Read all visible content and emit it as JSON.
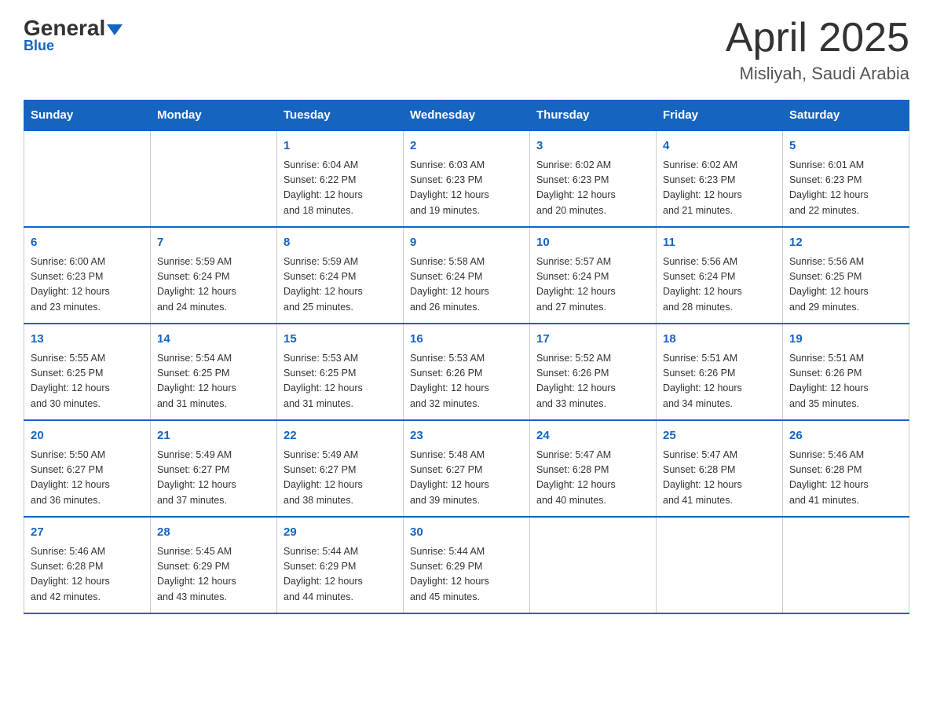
{
  "header": {
    "logo_general": "General",
    "logo_blue": "Blue",
    "month_year": "April 2025",
    "location": "Misliyah, Saudi Arabia"
  },
  "weekdays": [
    "Sunday",
    "Monday",
    "Tuesday",
    "Wednesday",
    "Thursday",
    "Friday",
    "Saturday"
  ],
  "weeks": [
    [
      {
        "day": "",
        "info": ""
      },
      {
        "day": "",
        "info": ""
      },
      {
        "day": "1",
        "info": "Sunrise: 6:04 AM\nSunset: 6:22 PM\nDaylight: 12 hours\nand 18 minutes."
      },
      {
        "day": "2",
        "info": "Sunrise: 6:03 AM\nSunset: 6:23 PM\nDaylight: 12 hours\nand 19 minutes."
      },
      {
        "day": "3",
        "info": "Sunrise: 6:02 AM\nSunset: 6:23 PM\nDaylight: 12 hours\nand 20 minutes."
      },
      {
        "day": "4",
        "info": "Sunrise: 6:02 AM\nSunset: 6:23 PM\nDaylight: 12 hours\nand 21 minutes."
      },
      {
        "day": "5",
        "info": "Sunrise: 6:01 AM\nSunset: 6:23 PM\nDaylight: 12 hours\nand 22 minutes."
      }
    ],
    [
      {
        "day": "6",
        "info": "Sunrise: 6:00 AM\nSunset: 6:23 PM\nDaylight: 12 hours\nand 23 minutes."
      },
      {
        "day": "7",
        "info": "Sunrise: 5:59 AM\nSunset: 6:24 PM\nDaylight: 12 hours\nand 24 minutes."
      },
      {
        "day": "8",
        "info": "Sunrise: 5:59 AM\nSunset: 6:24 PM\nDaylight: 12 hours\nand 25 minutes."
      },
      {
        "day": "9",
        "info": "Sunrise: 5:58 AM\nSunset: 6:24 PM\nDaylight: 12 hours\nand 26 minutes."
      },
      {
        "day": "10",
        "info": "Sunrise: 5:57 AM\nSunset: 6:24 PM\nDaylight: 12 hours\nand 27 minutes."
      },
      {
        "day": "11",
        "info": "Sunrise: 5:56 AM\nSunset: 6:24 PM\nDaylight: 12 hours\nand 28 minutes."
      },
      {
        "day": "12",
        "info": "Sunrise: 5:56 AM\nSunset: 6:25 PM\nDaylight: 12 hours\nand 29 minutes."
      }
    ],
    [
      {
        "day": "13",
        "info": "Sunrise: 5:55 AM\nSunset: 6:25 PM\nDaylight: 12 hours\nand 30 minutes."
      },
      {
        "day": "14",
        "info": "Sunrise: 5:54 AM\nSunset: 6:25 PM\nDaylight: 12 hours\nand 31 minutes."
      },
      {
        "day": "15",
        "info": "Sunrise: 5:53 AM\nSunset: 6:25 PM\nDaylight: 12 hours\nand 31 minutes."
      },
      {
        "day": "16",
        "info": "Sunrise: 5:53 AM\nSunset: 6:26 PM\nDaylight: 12 hours\nand 32 minutes."
      },
      {
        "day": "17",
        "info": "Sunrise: 5:52 AM\nSunset: 6:26 PM\nDaylight: 12 hours\nand 33 minutes."
      },
      {
        "day": "18",
        "info": "Sunrise: 5:51 AM\nSunset: 6:26 PM\nDaylight: 12 hours\nand 34 minutes."
      },
      {
        "day": "19",
        "info": "Sunrise: 5:51 AM\nSunset: 6:26 PM\nDaylight: 12 hours\nand 35 minutes."
      }
    ],
    [
      {
        "day": "20",
        "info": "Sunrise: 5:50 AM\nSunset: 6:27 PM\nDaylight: 12 hours\nand 36 minutes."
      },
      {
        "day": "21",
        "info": "Sunrise: 5:49 AM\nSunset: 6:27 PM\nDaylight: 12 hours\nand 37 minutes."
      },
      {
        "day": "22",
        "info": "Sunrise: 5:49 AM\nSunset: 6:27 PM\nDaylight: 12 hours\nand 38 minutes."
      },
      {
        "day": "23",
        "info": "Sunrise: 5:48 AM\nSunset: 6:27 PM\nDaylight: 12 hours\nand 39 minutes."
      },
      {
        "day": "24",
        "info": "Sunrise: 5:47 AM\nSunset: 6:28 PM\nDaylight: 12 hours\nand 40 minutes."
      },
      {
        "day": "25",
        "info": "Sunrise: 5:47 AM\nSunset: 6:28 PM\nDaylight: 12 hours\nand 41 minutes."
      },
      {
        "day": "26",
        "info": "Sunrise: 5:46 AM\nSunset: 6:28 PM\nDaylight: 12 hours\nand 41 minutes."
      }
    ],
    [
      {
        "day": "27",
        "info": "Sunrise: 5:46 AM\nSunset: 6:28 PM\nDaylight: 12 hours\nand 42 minutes."
      },
      {
        "day": "28",
        "info": "Sunrise: 5:45 AM\nSunset: 6:29 PM\nDaylight: 12 hours\nand 43 minutes."
      },
      {
        "day": "29",
        "info": "Sunrise: 5:44 AM\nSunset: 6:29 PM\nDaylight: 12 hours\nand 44 minutes."
      },
      {
        "day": "30",
        "info": "Sunrise: 5:44 AM\nSunset: 6:29 PM\nDaylight: 12 hours\nand 45 minutes."
      },
      {
        "day": "",
        "info": ""
      },
      {
        "day": "",
        "info": ""
      },
      {
        "day": "",
        "info": ""
      }
    ]
  ]
}
